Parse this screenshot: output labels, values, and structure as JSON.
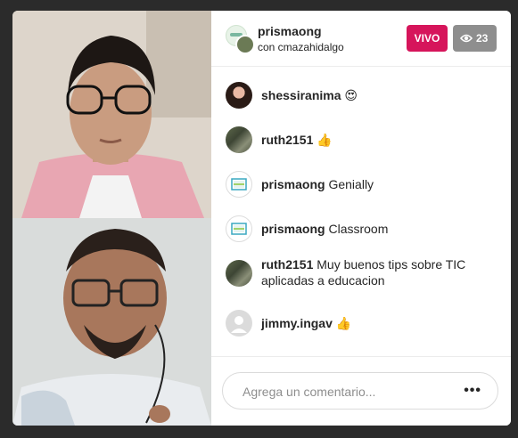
{
  "header": {
    "host_name": "prismaong",
    "subtitle": "con cmazahidalgo",
    "live_label": "VIVO",
    "viewer_count": "23"
  },
  "comments": [
    {
      "user": "shessiranima",
      "text": "😍",
      "avatar": "woman-avatar"
    },
    {
      "user": "ruth2151",
      "text": "👍",
      "avatar": "group-avatar"
    },
    {
      "user": "prismaong",
      "text": "Genially",
      "avatar": "prisma-logo-avatar"
    },
    {
      "user": "prismaong",
      "text": "Classroom",
      "avatar": "prisma-logo-avatar"
    },
    {
      "user": "ruth2151",
      "text": "Muy buenos tips sobre TIC aplicadas a educacion",
      "avatar": "group-avatar"
    },
    {
      "user": "jimmy.ingav",
      "text": "👍",
      "avatar": "default-avatar"
    }
  ],
  "composer": {
    "placeholder": "Agrega un comentario...",
    "more_label": "•••"
  },
  "colors": {
    "live": "#d6155b",
    "viewers": "#8e8e8e"
  },
  "icons": [
    "eye-icon",
    "more-options-icon"
  ]
}
